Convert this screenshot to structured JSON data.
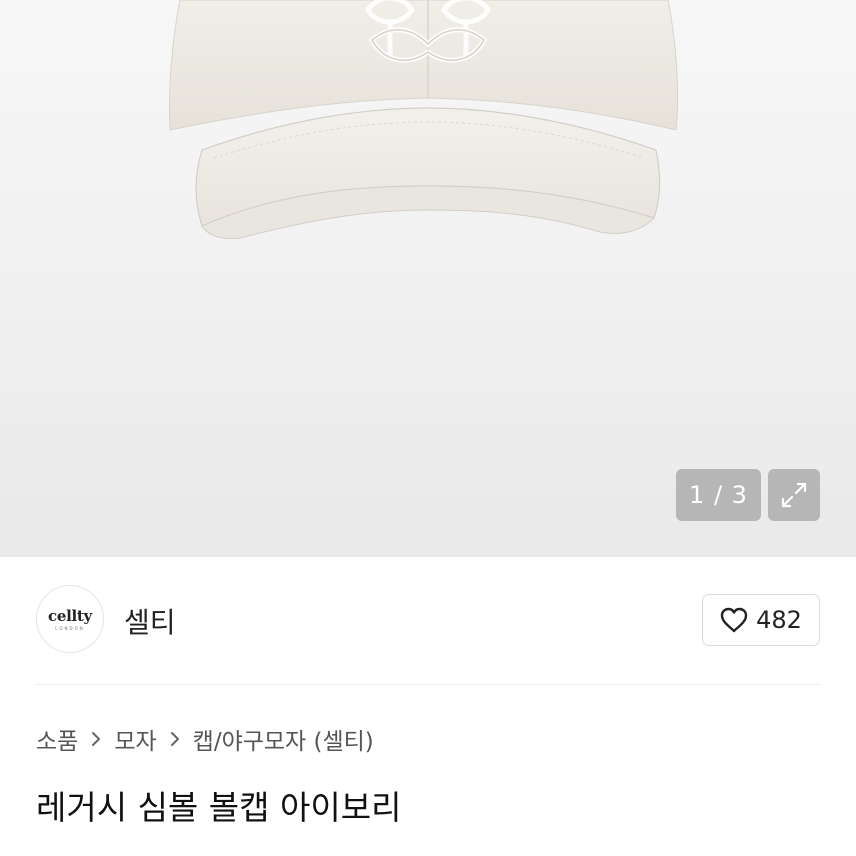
{
  "gallery": {
    "counter_text": "1 / 3",
    "expand_icon": "expand-icon",
    "image_desc_icon": "cap-product-image"
  },
  "shop": {
    "logo_text": "cellty",
    "logo_sub": "LONDON",
    "name": "셀티",
    "like_icon": "heart-icon",
    "like_count": "482"
  },
  "breadcrumb": {
    "items": [
      "소품",
      "모자",
      "캡/야구모자 (셀티)"
    ],
    "separator_icon": "chevron-right-icon"
  },
  "product": {
    "title": "레거시 심볼 볼캡 아이보리"
  },
  "colors": {
    "cap": "#eeeae3",
    "overlay": "#969696"
  }
}
